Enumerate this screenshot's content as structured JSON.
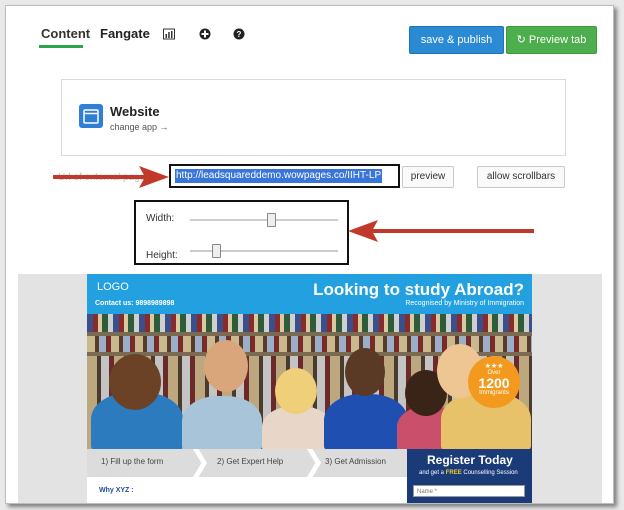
{
  "tabs": [
    {
      "label": "Content",
      "active": true
    },
    {
      "label": "Fangate",
      "active": false
    }
  ],
  "tab_icons": [
    "stats-icon",
    "plus-circle-icon",
    "help-circle-icon"
  ],
  "buttons": {
    "save_publish": "save & publish",
    "preview_tab": "Preview tab"
  },
  "app": {
    "title": "Website",
    "change": "change app →"
  },
  "url_row": {
    "label": "Url of external page",
    "value": "http://leadsquareddemo.wowpages.co/IIHT-LP",
    "preview": "preview",
    "scrollbars": "allow scrollbars"
  },
  "sliders": {
    "width_label": "Width:",
    "height_label": "Height:",
    "width_level": 0.55,
    "height_level": 0.18
  },
  "landing_page": {
    "logo": "LOGO",
    "contact": "Contact us: 9898989898",
    "title": "Looking to study Abroad?",
    "subtitle": "Recognised by Ministry of Immigration",
    "badge": {
      "stars": "★★★",
      "over": "Over",
      "number": "1200",
      "text": "Immigrants"
    },
    "steps": [
      "1) Fill up the form",
      "2) Get Expert Help",
      "3) Get Admission"
    ],
    "register_title": "Register Today",
    "register_sub_pre": "and get a",
    "register_sub_free": "FREE",
    "register_sub_post": "Counselling Session",
    "name_placeholder": "Name *",
    "why": "Why XYZ :"
  },
  "colors": {
    "primary_blue": "#2a8ad4",
    "primary_green": "#4cae4c",
    "tab_underline": "#2aa54a",
    "arrow": "#c0392b",
    "lp_header": "#22a0e0",
    "badge": "#f39a1e",
    "register_bg": "#1a3a78"
  }
}
